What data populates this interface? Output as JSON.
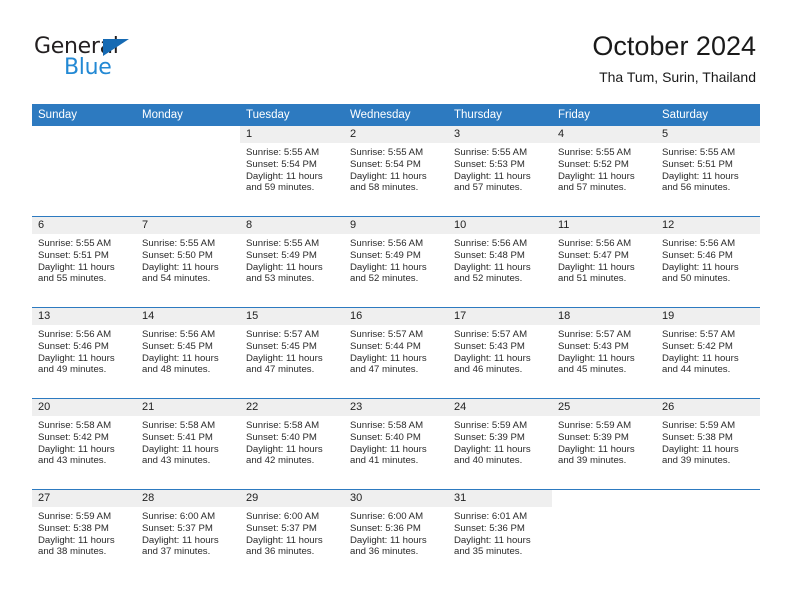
{
  "brand": {
    "name_part1": "General",
    "name_part2": "Blue",
    "accent_color": "#2389d4",
    "triangle_color": "#166ab3"
  },
  "header": {
    "title": "October 2024",
    "subtitle": "Tha Tum, Surin, Thailand"
  },
  "calendar": {
    "header_background": "#2d7ac0",
    "daynum_band_background": "#efefef",
    "weekdays": [
      "Sunday",
      "Monday",
      "Tuesday",
      "Wednesday",
      "Thursday",
      "Friday",
      "Saturday"
    ],
    "weeks": [
      [
        {
          "day": "",
          "empty": true
        },
        {
          "day": "",
          "empty": true
        },
        {
          "day": "1",
          "sunrise": "Sunrise: 5:55 AM",
          "sunset": "Sunset: 5:54 PM",
          "daylight": "Daylight: 11 hours and 59 minutes."
        },
        {
          "day": "2",
          "sunrise": "Sunrise: 5:55 AM",
          "sunset": "Sunset: 5:54 PM",
          "daylight": "Daylight: 11 hours and 58 minutes."
        },
        {
          "day": "3",
          "sunrise": "Sunrise: 5:55 AM",
          "sunset": "Sunset: 5:53 PM",
          "daylight": "Daylight: 11 hours and 57 minutes."
        },
        {
          "day": "4",
          "sunrise": "Sunrise: 5:55 AM",
          "sunset": "Sunset: 5:52 PM",
          "daylight": "Daylight: 11 hours and 57 minutes."
        },
        {
          "day": "5",
          "sunrise": "Sunrise: 5:55 AM",
          "sunset": "Sunset: 5:51 PM",
          "daylight": "Daylight: 11 hours and 56 minutes."
        }
      ],
      [
        {
          "day": "6",
          "sunrise": "Sunrise: 5:55 AM",
          "sunset": "Sunset: 5:51 PM",
          "daylight": "Daylight: 11 hours and 55 minutes."
        },
        {
          "day": "7",
          "sunrise": "Sunrise: 5:55 AM",
          "sunset": "Sunset: 5:50 PM",
          "daylight": "Daylight: 11 hours and 54 minutes."
        },
        {
          "day": "8",
          "sunrise": "Sunrise: 5:55 AM",
          "sunset": "Sunset: 5:49 PM",
          "daylight": "Daylight: 11 hours and 53 minutes."
        },
        {
          "day": "9",
          "sunrise": "Sunrise: 5:56 AM",
          "sunset": "Sunset: 5:49 PM",
          "daylight": "Daylight: 11 hours and 52 minutes."
        },
        {
          "day": "10",
          "sunrise": "Sunrise: 5:56 AM",
          "sunset": "Sunset: 5:48 PM",
          "daylight": "Daylight: 11 hours and 52 minutes."
        },
        {
          "day": "11",
          "sunrise": "Sunrise: 5:56 AM",
          "sunset": "Sunset: 5:47 PM",
          "daylight": "Daylight: 11 hours and 51 minutes."
        },
        {
          "day": "12",
          "sunrise": "Sunrise: 5:56 AM",
          "sunset": "Sunset: 5:46 PM",
          "daylight": "Daylight: 11 hours and 50 minutes."
        }
      ],
      [
        {
          "day": "13",
          "sunrise": "Sunrise: 5:56 AM",
          "sunset": "Sunset: 5:46 PM",
          "daylight": "Daylight: 11 hours and 49 minutes."
        },
        {
          "day": "14",
          "sunrise": "Sunrise: 5:56 AM",
          "sunset": "Sunset: 5:45 PM",
          "daylight": "Daylight: 11 hours and 48 minutes."
        },
        {
          "day": "15",
          "sunrise": "Sunrise: 5:57 AM",
          "sunset": "Sunset: 5:45 PM",
          "daylight": "Daylight: 11 hours and 47 minutes."
        },
        {
          "day": "16",
          "sunrise": "Sunrise: 5:57 AM",
          "sunset": "Sunset: 5:44 PM",
          "daylight": "Daylight: 11 hours and 47 minutes."
        },
        {
          "day": "17",
          "sunrise": "Sunrise: 5:57 AM",
          "sunset": "Sunset: 5:43 PM",
          "daylight": "Daylight: 11 hours and 46 minutes."
        },
        {
          "day": "18",
          "sunrise": "Sunrise: 5:57 AM",
          "sunset": "Sunset: 5:43 PM",
          "daylight": "Daylight: 11 hours and 45 minutes."
        },
        {
          "day": "19",
          "sunrise": "Sunrise: 5:57 AM",
          "sunset": "Sunset: 5:42 PM",
          "daylight": "Daylight: 11 hours and 44 minutes."
        }
      ],
      [
        {
          "day": "20",
          "sunrise": "Sunrise: 5:58 AM",
          "sunset": "Sunset: 5:42 PM",
          "daylight": "Daylight: 11 hours and 43 minutes."
        },
        {
          "day": "21",
          "sunrise": "Sunrise: 5:58 AM",
          "sunset": "Sunset: 5:41 PM",
          "daylight": "Daylight: 11 hours and 43 minutes."
        },
        {
          "day": "22",
          "sunrise": "Sunrise: 5:58 AM",
          "sunset": "Sunset: 5:40 PM",
          "daylight": "Daylight: 11 hours and 42 minutes."
        },
        {
          "day": "23",
          "sunrise": "Sunrise: 5:58 AM",
          "sunset": "Sunset: 5:40 PM",
          "daylight": "Daylight: 11 hours and 41 minutes."
        },
        {
          "day": "24",
          "sunrise": "Sunrise: 5:59 AM",
          "sunset": "Sunset: 5:39 PM",
          "daylight": "Daylight: 11 hours and 40 minutes."
        },
        {
          "day": "25",
          "sunrise": "Sunrise: 5:59 AM",
          "sunset": "Sunset: 5:39 PM",
          "daylight": "Daylight: 11 hours and 39 minutes."
        },
        {
          "day": "26",
          "sunrise": "Sunrise: 5:59 AM",
          "sunset": "Sunset: 5:38 PM",
          "daylight": "Daylight: 11 hours and 39 minutes."
        }
      ],
      [
        {
          "day": "27",
          "sunrise": "Sunrise: 5:59 AM",
          "sunset": "Sunset: 5:38 PM",
          "daylight": "Daylight: 11 hours and 38 minutes."
        },
        {
          "day": "28",
          "sunrise": "Sunrise: 6:00 AM",
          "sunset": "Sunset: 5:37 PM",
          "daylight": "Daylight: 11 hours and 37 minutes."
        },
        {
          "day": "29",
          "sunrise": "Sunrise: 6:00 AM",
          "sunset": "Sunset: 5:37 PM",
          "daylight": "Daylight: 11 hours and 36 minutes."
        },
        {
          "day": "30",
          "sunrise": "Sunrise: 6:00 AM",
          "sunset": "Sunset: 5:36 PM",
          "daylight": "Daylight: 11 hours and 36 minutes."
        },
        {
          "day": "31",
          "sunrise": "Sunrise: 6:01 AM",
          "sunset": "Sunset: 5:36 PM",
          "daylight": "Daylight: 11 hours and 35 minutes."
        },
        {
          "day": "",
          "empty": true
        },
        {
          "day": "",
          "empty": true
        }
      ]
    ]
  }
}
